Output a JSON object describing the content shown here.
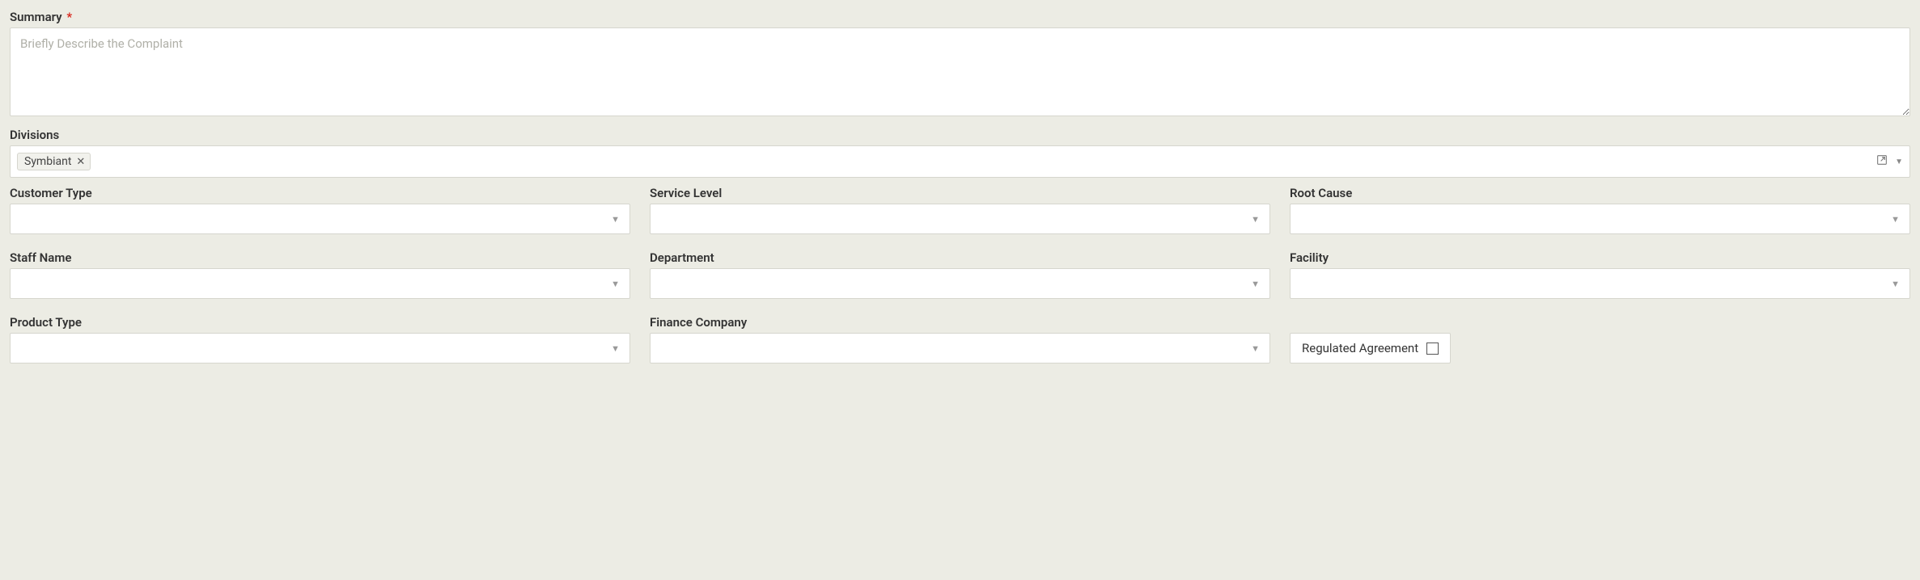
{
  "summary": {
    "label": "Summary",
    "required_mark": "*",
    "placeholder": "Briefly Describe the Complaint",
    "value": ""
  },
  "divisions": {
    "label": "Divisions",
    "tags": [
      "Symbiant"
    ]
  },
  "row1": {
    "customer_type": {
      "label": "Customer Type",
      "value": ""
    },
    "service_level": {
      "label": "Service Level",
      "value": ""
    },
    "root_cause": {
      "label": "Root Cause",
      "value": ""
    }
  },
  "row2": {
    "staff_name": {
      "label": "Staff Name",
      "value": ""
    },
    "department": {
      "label": "Department",
      "value": ""
    },
    "facility": {
      "label": "Facility",
      "value": ""
    }
  },
  "row3": {
    "product_type": {
      "label": "Product Type",
      "value": ""
    },
    "finance_company": {
      "label": "Finance Company",
      "value": ""
    },
    "regulated_agreement": {
      "label": "Regulated Agreement",
      "checked": false
    }
  }
}
